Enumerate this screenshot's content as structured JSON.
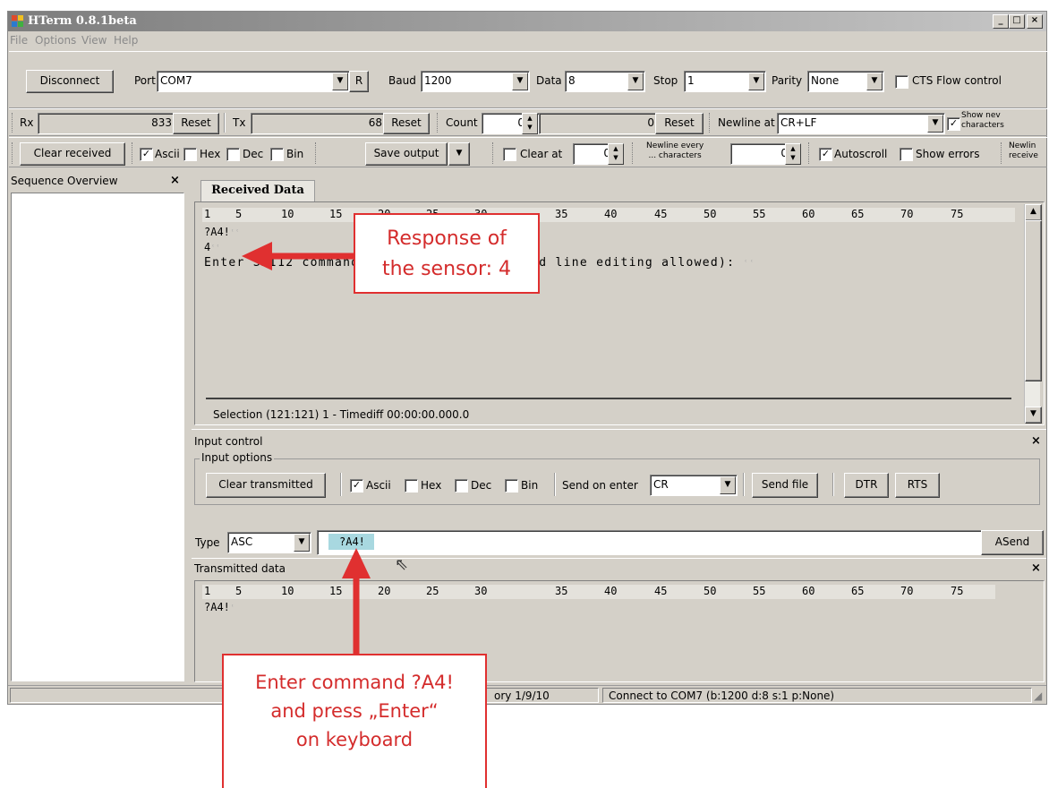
{
  "window": {
    "title": "HTerm 0.8.1beta",
    "controls": {
      "minimize": "_",
      "maximize": "□",
      "close": "×"
    }
  },
  "menu": [
    "File",
    "Options",
    "View",
    "Help"
  ],
  "connection": {
    "disconnect_label": "Disconnect",
    "port_label": "Port",
    "port_value": "COM7",
    "r_label": "R",
    "baud_label": "Baud",
    "baud_value": "1200",
    "data_label": "Data",
    "data_value": "8",
    "stop_label": "Stop",
    "stop_value": "1",
    "parity_label": "Parity",
    "parity_value": "None",
    "cts_label": "CTS Flow control",
    "cts_checked": false
  },
  "counters": {
    "rx_label": "Rx",
    "rx_value": "833",
    "rx_reset": "Reset",
    "tx_label": "Tx",
    "tx_value": "68",
    "tx_reset": "Reset",
    "count_label": "Count",
    "count_value": "0",
    "count_field": "0",
    "count_reset": "Reset",
    "newline_at_label": "Newline at",
    "newline_at_value": "CR+LF",
    "show_newline_label_1": "Show nev",
    "show_newline_label_2": "characters",
    "show_newline_checked": true
  },
  "display": {
    "clear_received": "Clear received",
    "ascii": "Ascii",
    "hex": "Hex",
    "dec": "Dec",
    "bin": "Bin",
    "save_output": "Save output",
    "clear_at": "Clear at",
    "clear_at_value": "0",
    "newline_every_1": "Newline every",
    "newline_every_2": "... characters",
    "newline_every_value": "0",
    "autoscroll": "Autoscroll",
    "show_errors": "Show errors",
    "newline_receive_1": "Newlin",
    "newline_receive_2": "receive"
  },
  "sequence_overview": {
    "title": "Sequence Overview",
    "close": "×"
  },
  "received": {
    "tab": "Received Data",
    "ruler": [
      "1",
      "5",
      "10",
      "15",
      "20",
      "25",
      "30",
      "35",
      "40",
      "45",
      "50",
      "55",
      "60",
      "65",
      "70",
      "75"
    ],
    "line1": "?A4!",
    "line2": "4",
    "line3": "Enter SDI12 command and return (no command line editing allowed):",
    "crlf": "ʿʿ",
    "selection": "Selection (121:121) 1  -  Timediff 00:00:00.000.0"
  },
  "input_control": {
    "title": "Input control",
    "close": "×",
    "options_label": "Input options",
    "clear_transmitted": "Clear transmitted",
    "ascii": "Ascii",
    "hex": "Hex",
    "dec": "Dec",
    "bin": "Bin",
    "send_on_enter_label": "Send on enter",
    "send_on_enter_value": "CR",
    "send_file": "Send file",
    "dtr": "DTR",
    "rts": "RTS",
    "type_label": "Type",
    "type_value": "ASC",
    "input_value": "?A4!",
    "asend": "ASend"
  },
  "transmitted": {
    "title": "Transmitted data",
    "close": "×",
    "line1": "?A4!"
  },
  "statusbar": {
    "history": "ory 1/9/10",
    "connection": "Connect to COM7 (b:1200 d:8 s:1 p:None)"
  },
  "annotations": {
    "response_line1": "Response of",
    "response_line2": "the sensor: 4",
    "enter_line1": "Enter command ?A4!",
    "enter_line2": "and press „Enter“",
    "enter_line3": "on keyboard"
  },
  "colors": {
    "annotation_red": "#e03030",
    "window_face": "#d4d0c8",
    "input_highlight": "#a8d8e0"
  }
}
